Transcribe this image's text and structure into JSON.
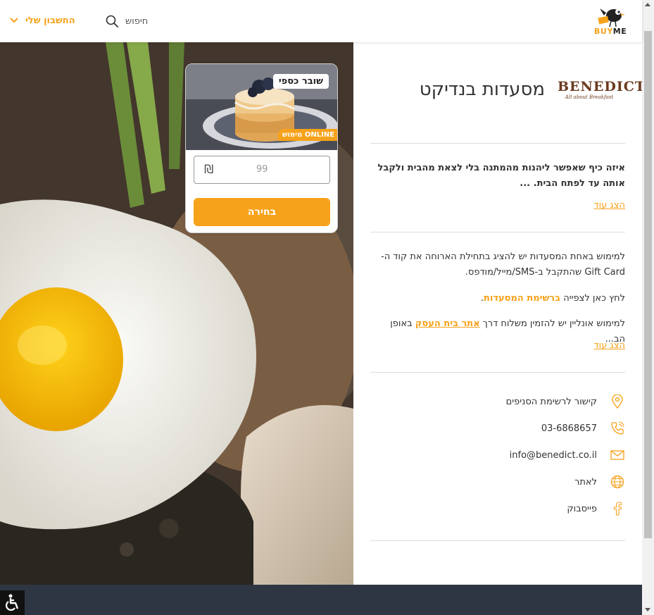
{
  "header": {
    "logo_buy": "BUY",
    "logo_me": "ME",
    "search_label": "חיפוש",
    "account_label": "החשבון שלי"
  },
  "voucher": {
    "type_badge": "שובר כספי",
    "online_badge": "מימוש ONLINE",
    "amount_value": "99",
    "currency_symbol": "₪",
    "choose_label": "בחירה"
  },
  "business": {
    "logo_name": "BENEDICT",
    "logo_tagline": "All about Breakfast",
    "title": "מסעדות בנדיקט",
    "description": "איזה כיף שאפשר ליהנות מהמתנה בלי לצאת מהבית ולקבל אותה עד לפתח הבית.  ...",
    "show_more_1": "הצג עוד",
    "redeem_text": "למימוש באחת המסעדות יש להציג בתחילת הארוחה את קוד ה-Gift Card שהתקבל ב-SMS/מייל/מודפס.",
    "list_prefix": "לחץ כאן לצפייה ",
    "list_link": "ברשימת המסעדות",
    "list_suffix": ".",
    "online_prefix": "למימוש אונליין יש להזמין משלוח דרך ",
    "online_link": "אתר בית העסק",
    "online_suffix": " באופן הב...",
    "show_more_2": "הצג עוד"
  },
  "contact": {
    "branches": "קישור לרשימת הסניפים",
    "phone": "03-6868657",
    "email": "info@benedict.co.il",
    "website": "לאתר",
    "facebook": "פייסבוק"
  },
  "colors": {
    "accent": "#f7a21b",
    "footer": "#2f3643"
  },
  "icons": [
    "search-icon",
    "chevron-down-icon",
    "location-icon",
    "phone-icon",
    "mail-icon",
    "globe-icon",
    "facebook-icon",
    "accessibility-icon"
  ]
}
